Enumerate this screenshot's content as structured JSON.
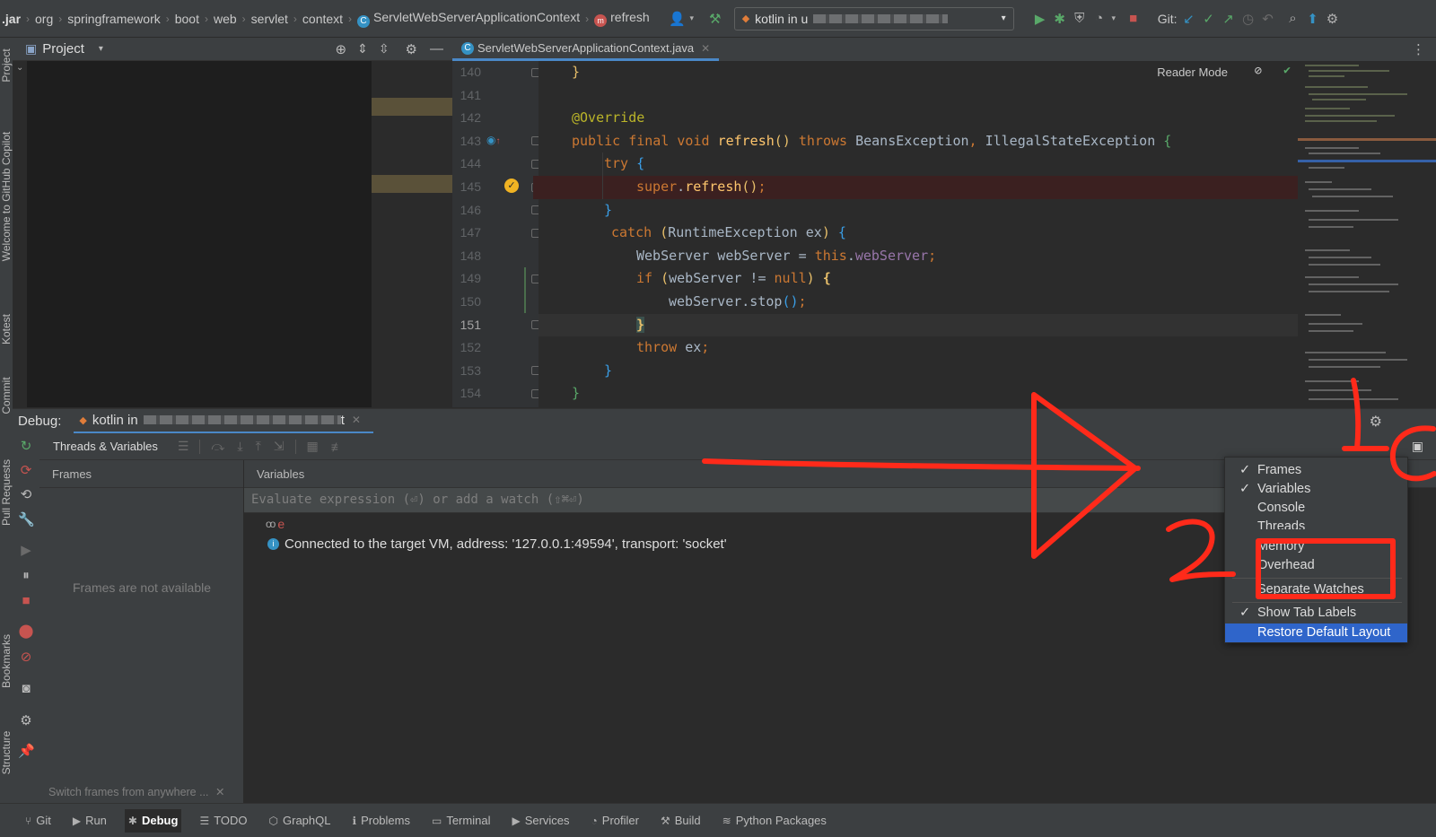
{
  "breadcrumbs": [
    ".jar",
    "org",
    "springframework",
    "boot",
    "web",
    "servlet",
    "context",
    "ServletWebServerApplicationContext",
    "refresh"
  ],
  "run_config": {
    "label": "kotlin in u"
  },
  "git_label": "Git:",
  "project_panel": {
    "title": "Project"
  },
  "editor": {
    "tab_label": "ServletWebServerApplicationContext.java",
    "reader_mode": "Reader Mode",
    "lines": [
      {
        "num": "140",
        "code": "}"
      },
      {
        "num": "141",
        "code": ""
      },
      {
        "num": "142",
        "code": "@Override"
      },
      {
        "num": "143",
        "code": "public final void refresh() throws BeansException, IllegalStateException {"
      },
      {
        "num": "144",
        "code": "try {"
      },
      {
        "num": "145",
        "code": "super.refresh();"
      },
      {
        "num": "146",
        "code": "}"
      },
      {
        "num": "147",
        "code": "catch (RuntimeException ex) {"
      },
      {
        "num": "148",
        "code": "WebServer webServer = this.webServer;"
      },
      {
        "num": "149",
        "code": "if (webServer != null) {"
      },
      {
        "num": "150",
        "code": "webServer.stop();"
      },
      {
        "num": "151",
        "code": "}"
      },
      {
        "num": "152",
        "code": "throw ex;"
      },
      {
        "num": "153",
        "code": "}"
      },
      {
        "num": "154",
        "code": "}"
      }
    ]
  },
  "debug": {
    "label": "Debug:",
    "session": "kotlin in",
    "session_suffix": "t",
    "threads_vars_tab": "Threads & Variables",
    "frames_header": "Frames",
    "variables_header": "Variables",
    "frames_empty": "Frames are not available",
    "frames_hint": "Switch frames from anywhere ...",
    "evaluate_placeholder": "Evaluate expression (⏎) or add a watch (⇧⌘⏎)",
    "var_name": "e",
    "connected_msg": "Connected to the target VM, address: '127.0.0.1:49594', transport: 'socket'"
  },
  "layout_menu": {
    "items": [
      {
        "label": "Frames",
        "checked": true
      },
      {
        "label": "Variables",
        "checked": true
      },
      {
        "label": "Console",
        "checked": false
      },
      {
        "label": "Threads",
        "checked": false
      },
      {
        "label": "Memory",
        "checked": false
      },
      {
        "label": "Overhead",
        "checked": false
      },
      {
        "label": "Separate Watches",
        "checked": false
      },
      {
        "label": "Show Tab Labels",
        "checked": true
      },
      {
        "label": "Restore Default Layout",
        "checked": false,
        "selected": true
      }
    ]
  },
  "left_strip_labels": [
    "Project",
    "Welcome to GitHub Copilot",
    "Kotest",
    "Commit",
    "Pull Requests",
    "Bookmarks",
    "Structure"
  ],
  "statusbar": [
    "Git",
    "Run",
    "Debug",
    "TODO",
    "GraphQL",
    "Problems",
    "Terminal",
    "Services",
    "Profiler",
    "Build",
    "Python Packages"
  ],
  "annotations": [
    "1",
    "2"
  ],
  "colors": {
    "accent": "#2f65ca",
    "annotation": "#ff2a1a",
    "error_line": "#3b2020",
    "editor_bg": "#2b2b2b"
  }
}
